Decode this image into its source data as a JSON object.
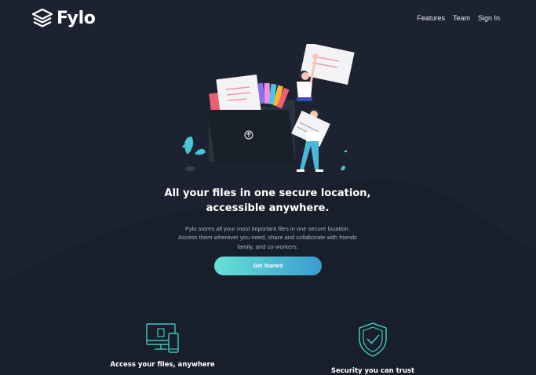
{
  "brand": {
    "name": "Fylo",
    "logo_icon": "layers-icon"
  },
  "nav": {
    "items": [
      "Features",
      "Team",
      "Sign In"
    ]
  },
  "hero": {
    "illustration": "people-uploading-files-illustration",
    "title_line1": "All your files in one secure location,",
    "title_line2": "accessible anywhere.",
    "body_line1": "Fylo stores all your most important files in one secure location.",
    "body_line2": "Access them wherever you need, share and collaborate with friends",
    "body_line3": "family, and co-workers.",
    "cta_label": "Get Started"
  },
  "features": [
    {
      "title": "Access your files, anywhere",
      "icon": "devices-icon"
    },
    {
      "title": "Security you can trust",
      "icon": "shield-check-icon"
    }
  ],
  "colors": {
    "background": "#181f2a",
    "hero_background": "#1c2230",
    "accent_cyan": "#67e1d4",
    "accent_blue": "#3a9ccf"
  }
}
